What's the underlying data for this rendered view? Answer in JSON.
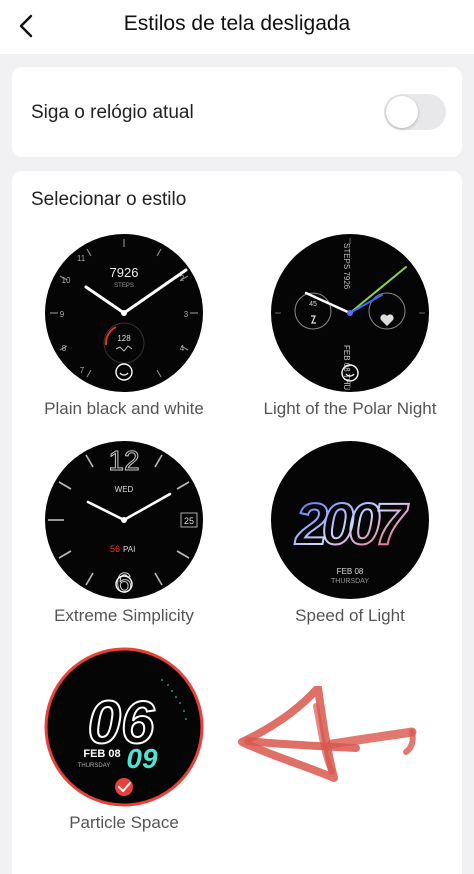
{
  "header": {
    "title": "Estilos de tela desligada",
    "back_icon": "chevron-left-icon"
  },
  "follow": {
    "label": "Siga o relógio atual",
    "enabled": false
  },
  "styles": {
    "section_title": "Selecionar o estilo",
    "faces": [
      {
        "label": "Plain black and white",
        "steps": "7926",
        "steps_label": "STEPS",
        "dial_value": "128",
        "selected": false
      },
      {
        "label": "Light of the Polar Night",
        "steps_text": "STEPS 7926",
        "date_text": "FEB 08 THU",
        "left_sub": "45",
        "selected": false
      },
      {
        "label": "Extreme Simplicity",
        "hour_top": "12",
        "hour_bottom": "6",
        "day": "WED",
        "date": "25",
        "pai_value": "56",
        "pai_label": "PAI",
        "selected": false
      },
      {
        "label": "Speed of Light",
        "year": "2007",
        "date": "FEB 08",
        "weekday": "THURSDAY",
        "selected": false
      },
      {
        "label": "Particle Space",
        "hour": "06",
        "minute": "09",
        "date": "FEB 08",
        "weekday": "THURSDAY",
        "selected": true
      }
    ]
  },
  "colors": {
    "accent_selected": "#e8413a",
    "annotation": "#d9574e",
    "polar_green": "#8fd14f",
    "polar_blue": "#3e66ff",
    "particle_teal": "#4fe3d0",
    "speed_red": "#ff3c55",
    "speed_blue": "#4a5cff"
  }
}
